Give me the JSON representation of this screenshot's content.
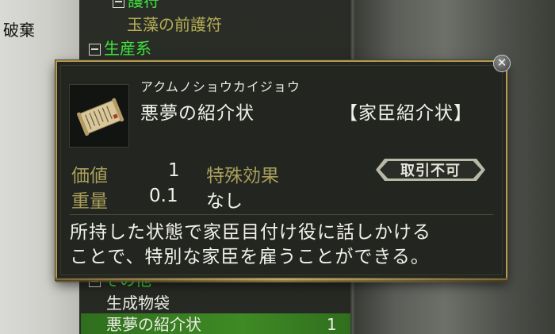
{
  "background": {
    "left_text": "破棄",
    "tree": {
      "cat1_label": "護符",
      "item1": "玉藻の前護符",
      "cat2_label": "生産系",
      "cat3_label": "その他",
      "item2": "生成物袋",
      "item3": "悪夢の紹介状",
      "item3_qty": "1"
    }
  },
  "popup": {
    "close_symbol": "✕",
    "reading": "アクムノショウカイジョウ",
    "name": "悪夢の紹介状",
    "type": "【家臣紹介状】",
    "stats": {
      "value_label": "価値",
      "value": "1",
      "weight_label": "重量",
      "weight": "0.1",
      "effect_label": "特殊効果",
      "effect": "なし"
    },
    "badge": "取引不可",
    "description_line1": "所持した状態で家臣目付け役に話しかける",
    "description_line2": "ことで、特別な家臣を雇うことができる。"
  },
  "colors": {
    "category_green": "#3ee23e",
    "stat_label_olive": "#a99f5b",
    "border_gold": "#b49a52",
    "highlight_green": "#3f8a25"
  },
  "icons": {
    "item": "scroll-icon",
    "close": "close-icon"
  }
}
